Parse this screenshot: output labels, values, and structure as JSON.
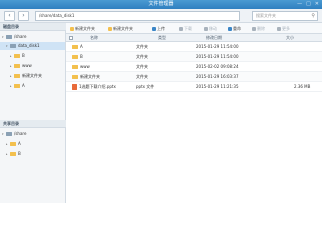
{
  "window": {
    "title": "文件管理器",
    "controls": [
      "—",
      "□",
      "✕"
    ]
  },
  "nav": {
    "back": "‹",
    "forward": "›",
    "path": "/share/data_disk1",
    "search_placeholder": "搜索文件夹"
  },
  "sidebar": {
    "section1": "磁盘目录",
    "section2": "共享目录",
    "tree": [
      {
        "label": "/share",
        "expander": "▾",
        "icon": "disk-icon"
      },
      {
        "label": "data_disk1",
        "expander": "▾",
        "icon": "disk-icon"
      },
      {
        "label": "B",
        "expander": "▸",
        "icon": "folder-icon"
      },
      {
        "label": "www",
        "expander": "▸",
        "icon": "folder-icon"
      },
      {
        "label": "新建文件夹",
        "expander": "▸",
        "icon": "folder-icon"
      },
      {
        "label": "A",
        "expander": "▸",
        "icon": "folder-icon"
      }
    ],
    "shared": [
      {
        "label": "/share",
        "expander": "▾",
        "icon": "disk-icon"
      },
      {
        "label": "A",
        "expander": "▸",
        "icon": "folder-icon"
      },
      {
        "label": "B",
        "expander": "▸",
        "icon": "folder-icon"
      }
    ]
  },
  "toolbar": {
    "buttons": [
      {
        "label": "新建文件夹",
        "color": "#f3c04e"
      },
      {
        "label": "新建文件夹",
        "color": "#f3c04e"
      },
      {
        "label": "上传",
        "color": "#3b86c7"
      },
      {
        "label": "下载",
        "color": "#a8b2bc"
      },
      {
        "label": "移动",
        "color": "#a8b2bc"
      },
      {
        "label": "重命",
        "color": "#3b86c7"
      },
      {
        "label": "删除",
        "color": "#a8b2bc"
      },
      {
        "label": "更多",
        "color": "#a8b2bc"
      }
    ]
  },
  "table": {
    "headers": {
      "name": "名称",
      "type": "类型",
      "modified": "修改日期",
      "size": "大小"
    },
    "rows": [
      {
        "name": "A",
        "type": "文件夹",
        "modified": "2015-01-29 11:54:00",
        "size": "",
        "icon": "folder-icon"
      },
      {
        "name": "B",
        "type": "文件夹",
        "modified": "2015-01-29 11:54:00",
        "size": "",
        "icon": "folder-icon"
      },
      {
        "name": "www",
        "type": "文件夹",
        "modified": "2015-02-02 09:08:24",
        "size": "",
        "icon": "folder-icon"
      },
      {
        "name": "新建文件夹",
        "type": "文件夹",
        "modified": "2015-01-29 16:03:37",
        "size": "",
        "icon": "folder-icon"
      },
      {
        "name": "1选题下载介绍.pptx",
        "type": "pptx 文件",
        "modified": "2015-01-29 11:21:35",
        "size": "2.36 MB",
        "icon": "pptx-file-icon"
      }
    ]
  },
  "colors": {
    "accent": "#2f7fc0",
    "folder": "#f3c04e",
    "selected": "#cfe3f5"
  }
}
